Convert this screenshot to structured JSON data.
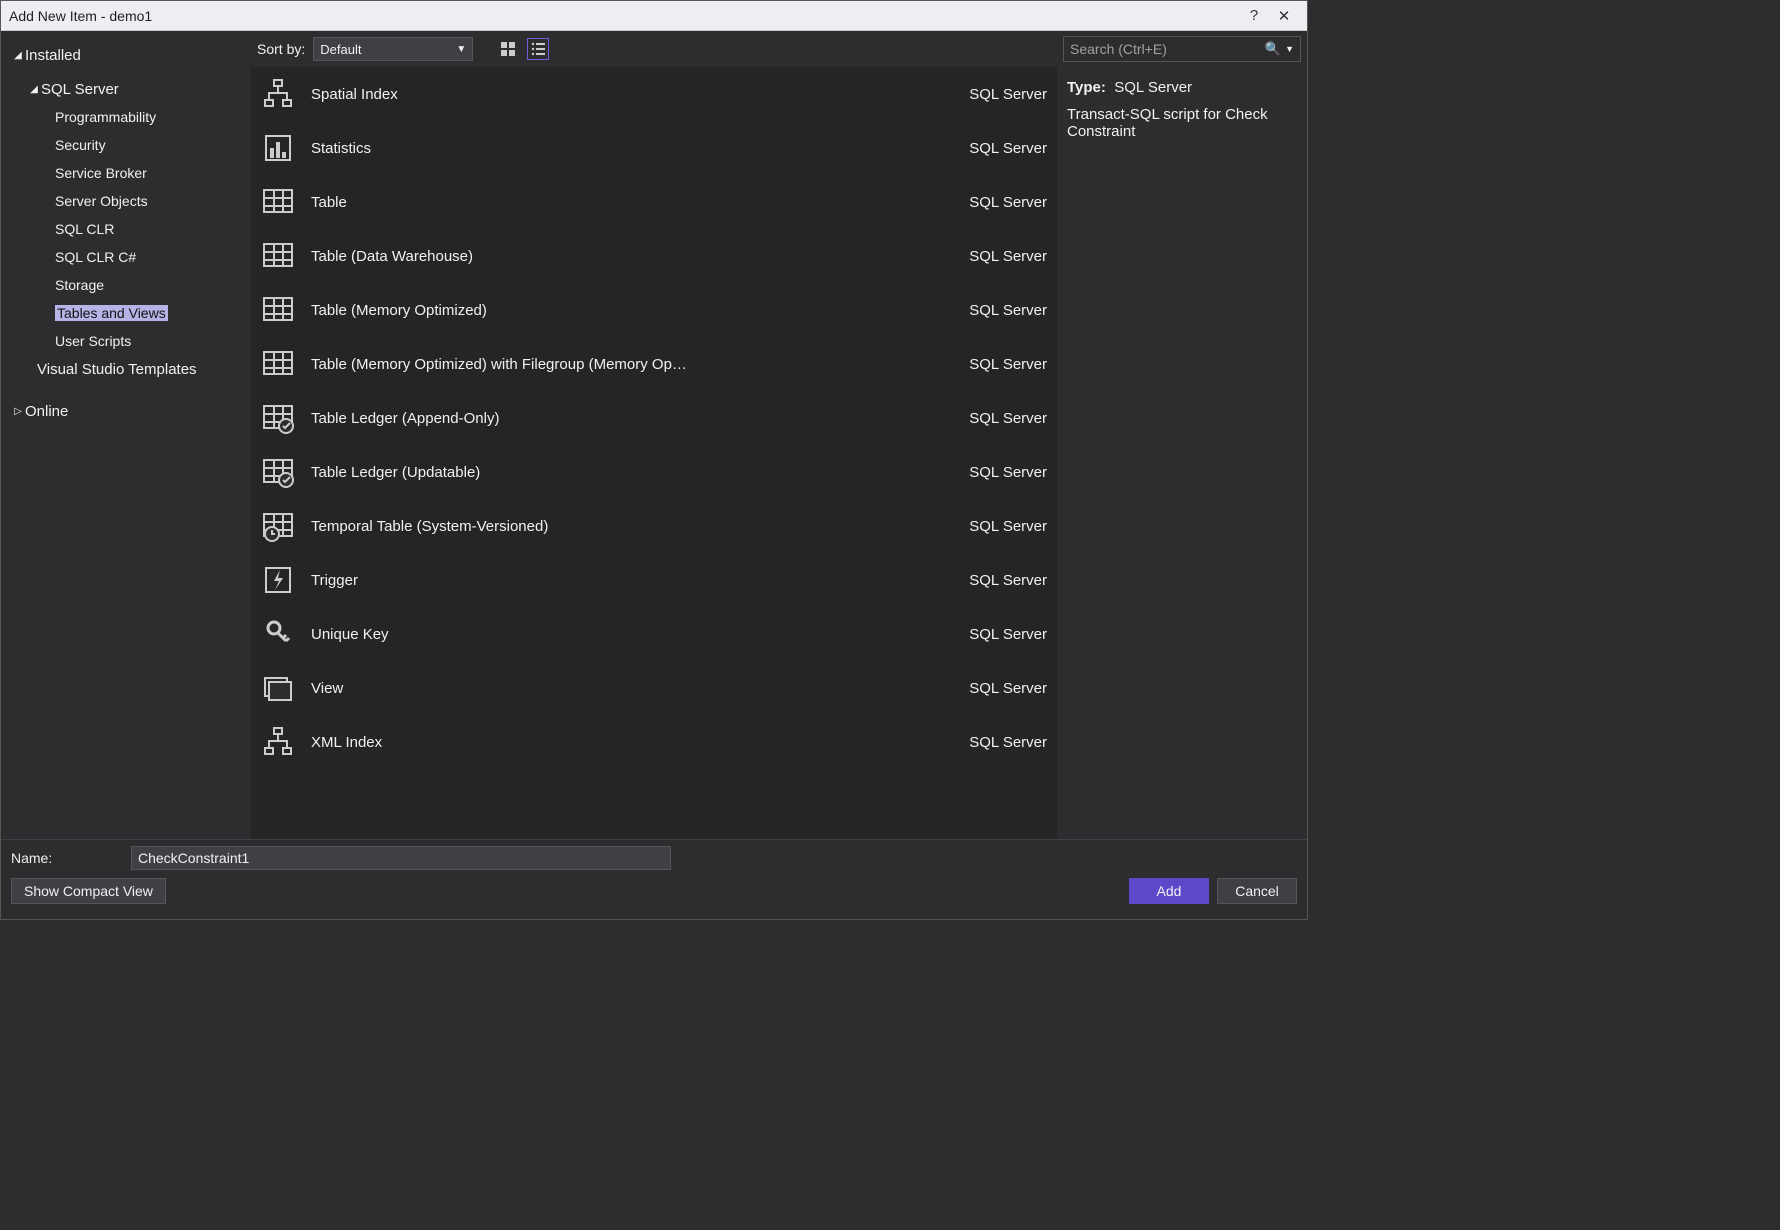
{
  "window": {
    "title": "Add New Item - demo1"
  },
  "sidebar": {
    "installed_label": "Installed",
    "online_label": "Online",
    "sqlserver_label": "SQL Server",
    "items": [
      "Programmability",
      "Security",
      "Service Broker",
      "Server Objects",
      "SQL CLR",
      "SQL CLR C#",
      "Storage",
      "Tables and Views",
      "User Scripts"
    ],
    "selected_index": 7,
    "extra_label": "Visual Studio Templates"
  },
  "toolbar": {
    "sort_label": "Sort by:",
    "sort_value": "Default"
  },
  "search": {
    "placeholder": "Search (Ctrl+E)"
  },
  "templates": [
    {
      "name": "Spatial Index",
      "cat": "SQL Server",
      "icon": "hierarchy"
    },
    {
      "name": "Statistics",
      "cat": "SQL Server",
      "icon": "barchart"
    },
    {
      "name": "Table",
      "cat": "SQL Server",
      "icon": "table"
    },
    {
      "name": "Table (Data Warehouse)",
      "cat": "SQL Server",
      "icon": "table"
    },
    {
      "name": "Table (Memory Optimized)",
      "cat": "SQL Server",
      "icon": "table"
    },
    {
      "name": "Table (Memory Optimized) with Filegroup (Memory Op…",
      "cat": "SQL Server",
      "icon": "table"
    },
    {
      "name": "Table Ledger (Append-Only)",
      "cat": "SQL Server",
      "icon": "table-check"
    },
    {
      "name": "Table Ledger (Updatable)",
      "cat": "SQL Server",
      "icon": "table-check"
    },
    {
      "name": "Temporal Table (System-Versioned)",
      "cat": "SQL Server",
      "icon": "table-clock"
    },
    {
      "name": "Trigger",
      "cat": "SQL Server",
      "icon": "bolt"
    },
    {
      "name": "Unique Key",
      "cat": "SQL Server",
      "icon": "key"
    },
    {
      "name": "View",
      "cat": "SQL Server",
      "icon": "view"
    },
    {
      "name": "XML Index",
      "cat": "SQL Server",
      "icon": "hierarchy"
    }
  ],
  "details": {
    "type_label": "Type:",
    "type_value": "SQL Server",
    "description": "Transact-SQL script for Check Constraint"
  },
  "footer": {
    "name_label": "Name:",
    "name_value": "CheckConstraint1",
    "compact_label": "Show Compact View",
    "add_label": "Add",
    "cancel_label": "Cancel"
  }
}
